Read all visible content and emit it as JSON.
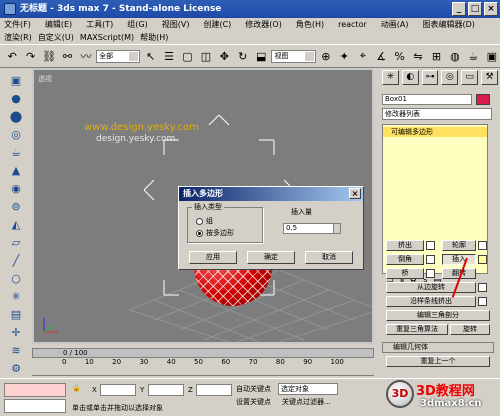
{
  "titlebar": {
    "title": "无标题 - 3ds max 7 - Stand-alone License",
    "min": "_",
    "max": "□",
    "close": "×"
  },
  "menu": {
    "items": [
      "文件(F)",
      "编辑(E)",
      "工具(T)",
      "组(G)",
      "视图(V)",
      "创建(C)",
      "修改器(O)",
      "角色(H)",
      "reactor",
      "动画(A)",
      "图表编辑器(D)"
    ]
  },
  "menu2": {
    "items": [
      "渲染(R)",
      "自定义(U)",
      "MAXScript(M)",
      "帮助(H)"
    ]
  },
  "toolbar": {
    "selection_filter": "全部",
    "view_dropdown": "视图"
  },
  "viewport": {
    "label": "透视",
    "watermark1": "www.design.yesky.com",
    "watermark2": "design.yesky.com"
  },
  "dialog": {
    "title": "插入多边形",
    "group_label": "插入类型",
    "radio1": "组",
    "radio2": "按多边形",
    "amount_label": "插入量",
    "amount_value": "0.5",
    "btn_apply": "应用",
    "btn_ok": "确定",
    "btn_cancel": "取消",
    "close": "×"
  },
  "panel": {
    "object_name": "Box01",
    "modifier_list": "修改器列表",
    "stack_item": "可编辑多边形",
    "buttons": {
      "extrude": "挤出",
      "outline": "轮廓",
      "bevel": "倒角",
      "inset": "插入",
      "hinge_label": "桥",
      "flip": "翻转",
      "hinge_from_edge": "从边旋转",
      "extrude_along_spline": "沿样条线挤出",
      "edit_triangulation": "编辑三角剖分",
      "retriangulate": "重复三角算法",
      "turn": "旋转",
      "rollout_geometry": "编辑几何体",
      "repeat_last": "重复上一个"
    }
  },
  "timeline": {
    "frame": "0 / 100",
    "ticks": [
      "0",
      "10",
      "20",
      "30",
      "40",
      "50",
      "60",
      "70",
      "80",
      "90",
      "100"
    ]
  },
  "status": {
    "auto_key": "自动关键点",
    "set_key": "设置关键点",
    "selected_label": "选定对象",
    "key_filters": "关键点过滤器...",
    "hint": "单击或单击并拖动以选择对象",
    "x_label": "X",
    "y_label": "Y",
    "z_label": "Z"
  },
  "logo": {
    "brand": "3D教程网",
    "url": "3dmax8.cn"
  }
}
